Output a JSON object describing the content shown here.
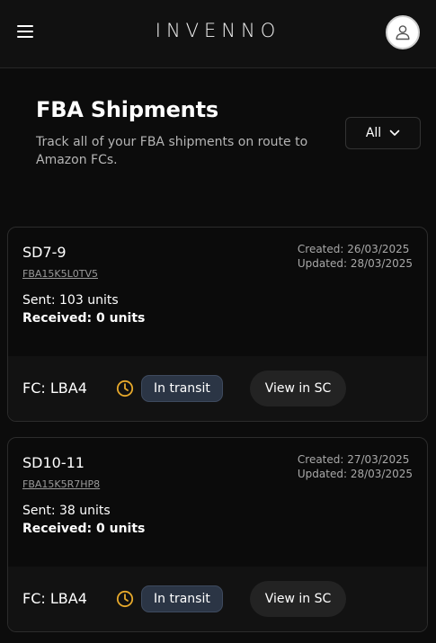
{
  "header": {
    "brand": "INVENNO",
    "menu_icon": "hamburger-menu-icon",
    "avatar_icon": "user-icon"
  },
  "page": {
    "title": "FBA Shipments",
    "subtitle": "Track all of your FBA shipments on route to Amazon FCs."
  },
  "filter": {
    "label": "All",
    "icon": "chevron-down-icon"
  },
  "shipments": [
    {
      "id": "SD7-9",
      "reference": "FBA15K5L0TV5",
      "created": "Created: 26/03/2025",
      "updated": "Updated: 28/03/2025",
      "sent": "Sent: 103 units",
      "received": "Received: 0 units",
      "fc": "FC: LBA4",
      "status": "In transit",
      "status_icon": "clock-icon",
      "action_label": "View in SC"
    },
    {
      "id": "SD10-11",
      "reference": "FBA15K5R7HP8",
      "created": "Created: 27/03/2025",
      "updated": "Updated: 28/03/2025",
      "sent": "Sent: 38 units",
      "received": "Received: 0 units",
      "fc": "FC: LBA4",
      "status": "In transit",
      "status_icon": "clock-icon",
      "action_label": "View in SC"
    }
  ],
  "colors": {
    "background": "#0c0c0c",
    "status_badge": "#2b3545",
    "clock_accent": "#e7a92b"
  }
}
